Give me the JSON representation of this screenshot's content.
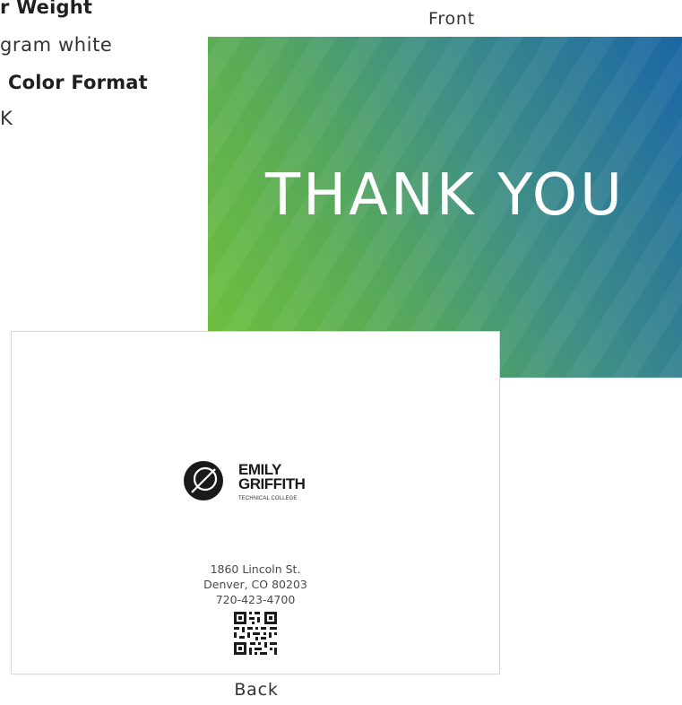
{
  "specs": {
    "paper_weight_label": "r Weight",
    "paper_weight_value": "gram white",
    "color_format_label": "Color Format",
    "color_format_value": "K"
  },
  "captions": {
    "front": "Front",
    "back": "Back"
  },
  "front_card": {
    "headline": "THANK YOU",
    "gradient_colors": [
      "#6fc23a",
      "#3f8f86",
      "#1a66a6"
    ]
  },
  "back_card": {
    "logo": {
      "name_line1": "EMILY",
      "name_line2": "GRIFFITH",
      "subtitle": "TECHNICAL COLLEGE"
    },
    "address": {
      "street": "1860 Lincoln St.",
      "city": "Denver, CO 80203",
      "phone": "720-423-4700"
    },
    "qr_icon": "qr-code-icon"
  }
}
